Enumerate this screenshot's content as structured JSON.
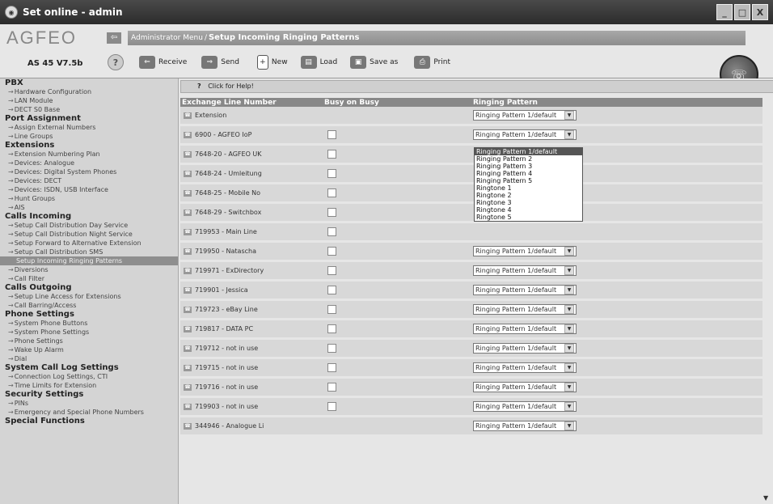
{
  "window": {
    "title": "Set online - admin",
    "controls": [
      "_",
      "□",
      "X"
    ]
  },
  "header": {
    "logo": "AGFEO",
    "back_icon": "back-arrow-icon",
    "breadcrumb_root": "Administrator Menu",
    "breadcrumb_sep": "/",
    "breadcrumb_current": "Setup Incoming Ringing Patterns",
    "version": "AS 45 V7.5b",
    "help_glyph": "?"
  },
  "toolbar": [
    {
      "label": "Receive",
      "icon": "receive-icon"
    },
    {
      "label": "Send",
      "icon": "send-icon"
    },
    {
      "label": "New",
      "icon": "new-icon"
    },
    {
      "label": "Load",
      "icon": "load-icon"
    },
    {
      "label": "Save as",
      "icon": "save-icon"
    },
    {
      "label": "Print",
      "icon": "print-icon"
    }
  ],
  "sidebar": [
    {
      "type": "heading",
      "label": "PBX"
    },
    {
      "type": "item",
      "label": "Hardware Configuration"
    },
    {
      "type": "item",
      "label": "LAN Module"
    },
    {
      "type": "item",
      "label": "DECT S0 Base"
    },
    {
      "type": "heading",
      "label": "Port Assignment"
    },
    {
      "type": "item",
      "label": "Assign External Numbers"
    },
    {
      "type": "item",
      "label": "Line Groups"
    },
    {
      "type": "heading",
      "label": "Extensions"
    },
    {
      "type": "item",
      "label": "Extension Numbering Plan"
    },
    {
      "type": "item",
      "label": "Devices: Analogue"
    },
    {
      "type": "item",
      "label": "Devices: Digital System Phones"
    },
    {
      "type": "item",
      "label": "Devices: DECT"
    },
    {
      "type": "item",
      "label": "Devices: ISDN, USB Interface"
    },
    {
      "type": "item",
      "label": "Hunt Groups"
    },
    {
      "type": "item",
      "label": "AIS"
    },
    {
      "type": "heading",
      "label": "Calls Incoming"
    },
    {
      "type": "item",
      "label": "Setup Call Distribution Day Service"
    },
    {
      "type": "item",
      "label": "Setup Call Distribution Night Service"
    },
    {
      "type": "item",
      "label": "Setup Forward to Alternative Extension"
    },
    {
      "type": "item",
      "label": "Setup Call Distribution SMS"
    },
    {
      "type": "active",
      "label": "Setup Incoming Ringing Patterns"
    },
    {
      "type": "item",
      "label": "Diversions"
    },
    {
      "type": "item",
      "label": "Call Filter"
    },
    {
      "type": "heading",
      "label": "Calls Outgoing"
    },
    {
      "type": "item",
      "label": "Setup Line Access for Extensions"
    },
    {
      "type": "item",
      "label": "Call Barring/Access"
    },
    {
      "type": "heading",
      "label": "Phone Settings"
    },
    {
      "type": "item",
      "label": "System Phone Buttons"
    },
    {
      "type": "item",
      "label": "System Phone Settings"
    },
    {
      "type": "item",
      "label": "Phone Settings"
    },
    {
      "type": "item",
      "label": "Wake Up Alarm"
    },
    {
      "type": "item",
      "label": "Dial"
    },
    {
      "type": "heading",
      "label": "System Call Log Settings"
    },
    {
      "type": "item",
      "label": "Connection Log Settings, CTI"
    },
    {
      "type": "item",
      "label": "Time Limits for Extension"
    },
    {
      "type": "heading",
      "label": "Security Settings"
    },
    {
      "type": "item",
      "label": "PINs"
    },
    {
      "type": "item",
      "label": "Emergency and Special Phone Numbers"
    },
    {
      "type": "heading",
      "label": "Special Functions"
    }
  ],
  "helpbar": {
    "glyph": "?",
    "label": "Click for Help!"
  },
  "table": {
    "columns": [
      "Exchange Line Number",
      "Busy on Busy",
      "Ringing Pattern"
    ],
    "rows": [
      {
        "line": "Extension",
        "checkbox": false,
        "pattern": "Ringing Pattern 1/default"
      },
      {
        "line": "6900 - AGFEO IoP",
        "checkbox": true,
        "pattern": "Ringing Pattern 1/default"
      },
      {
        "line": "7648-20 - AGFEO UK",
        "checkbox": true,
        "pattern": ""
      },
      {
        "line": "7648-24 - Umleitung",
        "checkbox": true,
        "pattern": ""
      },
      {
        "line": "7648-25 - Mobile No",
        "checkbox": true,
        "pattern": ""
      },
      {
        "line": "7648-29 - Switchbox",
        "checkbox": true,
        "pattern": ""
      },
      {
        "line": "719953 - Main Line",
        "checkbox": true,
        "pattern": ""
      },
      {
        "line": "719950 - Natascha",
        "checkbox": true,
        "pattern": "Ringing Pattern 1/default"
      },
      {
        "line": "719971 - ExDirectory",
        "checkbox": true,
        "pattern": "Ringing Pattern 1/default"
      },
      {
        "line": "719901 - Jessica",
        "checkbox": true,
        "pattern": "Ringing Pattern 1/default"
      },
      {
        "line": "719723 - eBay Line",
        "checkbox": true,
        "pattern": "Ringing Pattern 1/default"
      },
      {
        "line": "719817 - DATA PC",
        "checkbox": true,
        "pattern": "Ringing Pattern 1/default"
      },
      {
        "line": "719712 - not in use",
        "checkbox": true,
        "pattern": "Ringing Pattern 1/default"
      },
      {
        "line": "719715 - not in use",
        "checkbox": true,
        "pattern": "Ringing Pattern 1/default"
      },
      {
        "line": "719716 - not in use",
        "checkbox": true,
        "pattern": "Ringing Pattern 1/default"
      },
      {
        "line": "719903 - not in use",
        "checkbox": true,
        "pattern": "Ringing Pattern 1/default"
      },
      {
        "line": "344946 - Analogue Li",
        "checkbox": false,
        "pattern": "Ringing Pattern 1/default"
      }
    ]
  },
  "dropdown": {
    "selected": "Ringing Pattern 1/default",
    "options": [
      "Ringing Pattern 1/default",
      "Ringing Pattern 2",
      "Ringing Pattern 3",
      "Ringing Pattern 4",
      "Ringing Pattern 5",
      "Ringtone 1",
      "Ringtone 2",
      "Ringtone 3",
      "Ringtone 4",
      "Ringtone 5"
    ]
  }
}
